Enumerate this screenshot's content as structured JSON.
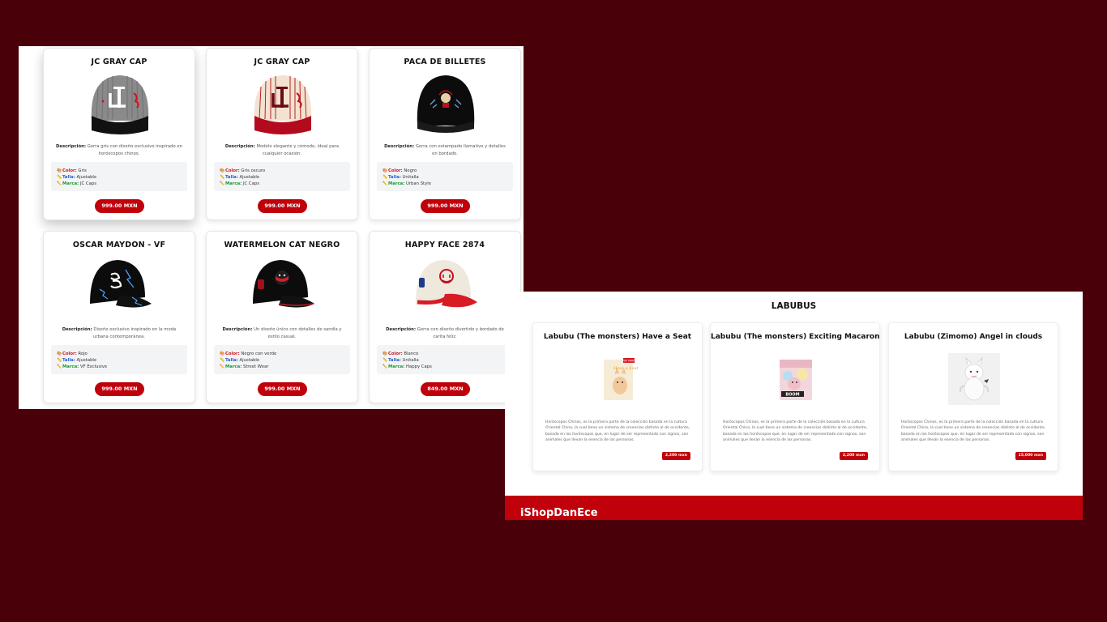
{
  "caps": [
    {
      "title": "JC GRAY CAP",
      "desc_label": "Descripción:",
      "desc": "Gorra gris con diseño exclusivo inspirado en horóscopos chinos.",
      "color_label": "Color:",
      "color": "Gris",
      "talla_label": "Talla:",
      "talla": "Ajustable",
      "marca_label": "Marca:",
      "marca": "JC Caps",
      "price": "999.00 MXN"
    },
    {
      "title": "JC GRAY CAP",
      "desc_label": "Descripción:",
      "desc": "Modelo elegante y cómodo, ideal para cualquier ocasión.",
      "color_label": "Color:",
      "color": "Gris oscuro",
      "talla_label": "Talla:",
      "talla": "Ajustable",
      "marca_label": "Marca:",
      "marca": "JC Caps",
      "price": "999.00 MXN"
    },
    {
      "title": "PACA DE BILLETES",
      "desc_label": "Descripción:",
      "desc": "Gorra con estampado llamativo y detalles en bordado.",
      "color_label": "Color:",
      "color": "Negro",
      "talla_label": "Talla:",
      "talla": "Unitalla",
      "marca_label": "Marca:",
      "marca": "Urban Style",
      "price": "999.00 MXN"
    },
    {
      "title": "OSCAR MAYDON - VF",
      "desc_label": "Descripción:",
      "desc": "Diseño exclusivo inspirado en la moda urbana contemporánea.",
      "color_label": "Color:",
      "color": "Rojo",
      "talla_label": "Talla:",
      "talla": "Ajustable",
      "marca_label": "Marca:",
      "marca": "VF Exclusive",
      "price": "999.00 MXN"
    },
    {
      "title": "WATERMELON CAT NEGRO",
      "desc_label": "Descripción:",
      "desc": "Un diseño único con detalles de sandía y estilo casual.",
      "color_label": "Color:",
      "color": "Negro con verde",
      "talla_label": "Talla:",
      "talla": "Ajustable",
      "marca_label": "Marca:",
      "marca": "Street Wear",
      "price": "999.00 MXN"
    },
    {
      "title": "HAPPY FACE 2874",
      "desc_label": "Descripción:",
      "desc": "Gorra con diseño divertido y bordado de carita feliz.",
      "color_label": "Color:",
      "color": "Blanco",
      "talla_label": "Talla:",
      "talla": "Unitalla",
      "marca_label": "Marca:",
      "marca": "Happy Caps",
      "price": "849.00 MXN"
    }
  ],
  "labubus": {
    "section_title": "LABUBUS",
    "items": [
      {
        "title": "Labubu (The monsters) Have a Seat",
        "desc": "Horóscopos Chinos, es la primera parte de la colección basada en la cultura Oriental China, la cual tiene un sistema de creencias distinto al de occidente, basada en los horóscopos que, en lugar de ser representado con signos, son animales que llevan la esencia de las personas.",
        "price": "2,200 mxn",
        "box_tag": "POP MART"
      },
      {
        "title": "Labubu (The monsters) Exciting Macaron",
        "desc": "Horóscopos Chinos, es la primera parte de la colección basada en la cultura Oriental China, la cual tiene un sistema de creencias distinto al de occidente, basada en los horóscopos que, en lugar de ser representado con signos, son animales que llevan la esencia de las personas.",
        "price": "2,200 mxn",
        "box_tag": "BOOM"
      },
      {
        "title": "Labubu (Zimomo) Angel in clouds",
        "desc": "Horóscopos Chinos, es la primera parte de la colección basada en la cultura Oriental China, la cual tiene un sistema de creencias distinto al de occidente, basada en los horóscopos que, en lugar de ser representado con signos, son animales que llevan la esencia de las personas.",
        "price": "15,000 mxn"
      }
    ]
  },
  "footer": {
    "brand": "iShopDanEce"
  },
  "colors": {
    "background": "#4a0008",
    "accent": "#c0000b",
    "color_label": "#c8151d",
    "talla_label": "#2a62c9",
    "marca_label": "#1b9a2e"
  },
  "icons": {
    "color": "palette-icon",
    "talla": "ruler-icon",
    "marca": "pencil-icon"
  }
}
